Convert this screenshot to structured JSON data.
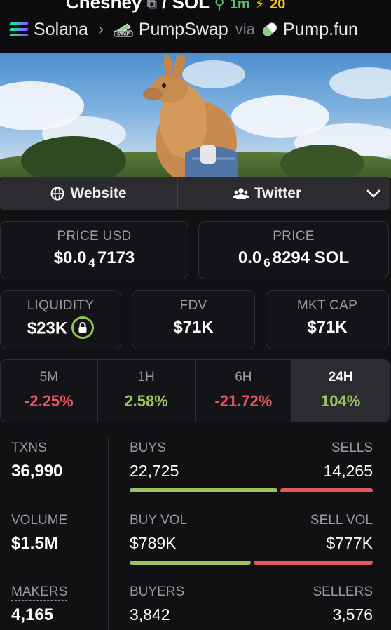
{
  "header": {
    "token_name": "Chesney",
    "pair": "/ SOL",
    "age": "1m",
    "boost": "20",
    "breadcrumb": {
      "chain": "Solana",
      "dex": "PumpSwap",
      "via": "via",
      "launchpad": "Pump.fun",
      "dex_icon_text": "SWAP"
    }
  },
  "links": {
    "website": "Website",
    "twitter": "Twitter"
  },
  "price": {
    "usd_label": "PRICE USD",
    "usd_prefix": "$0.0",
    "usd_zeros": "4",
    "usd_digits": "7173",
    "native_label": "PRICE",
    "native_prefix": "0.0",
    "native_zeros": "6",
    "native_digits": "8294 SOL"
  },
  "metrics": {
    "liquidity_label": "LIQUIDITY",
    "liquidity_value": "$23K",
    "fdv_label": "FDV",
    "fdv_value": "$71K",
    "mcap_label": "MKT CAP",
    "mcap_value": "$71K"
  },
  "periods": [
    {
      "label": "5M",
      "change": "-2.25%",
      "trend": "neg"
    },
    {
      "label": "1H",
      "change": "2.58%",
      "trend": "pos"
    },
    {
      "label": "6H",
      "change": "-21.72%",
      "trend": "neg"
    },
    {
      "label": "24H",
      "change": "104%",
      "trend": "pos",
      "active": true
    }
  ],
  "stats": {
    "txns_label": "TXNS",
    "txns_value": "36,990",
    "buys_label": "BUYS",
    "buys_value": "22,725",
    "sells_label": "SELLS",
    "sells_value": "14,265",
    "buys_fraction": 0.614,
    "volume_label": "VOLUME",
    "volume_value": "$1.5M",
    "buyvol_label": "BUY VOL",
    "buyvol_value": "$789K",
    "sellvol_label": "SELL VOL",
    "sellvol_value": "$777K",
    "buyvol_fraction": 0.504,
    "makers_label": "MAKERS",
    "makers_value": "4,165",
    "buyers_label": "BUYERS",
    "buyers_value": "3,842",
    "sellers_label": "SELLERS",
    "sellers_value": "3,576"
  },
  "colors": {
    "positive": "#9bc45f",
    "negative": "#e4575d",
    "background": "#111114"
  }
}
